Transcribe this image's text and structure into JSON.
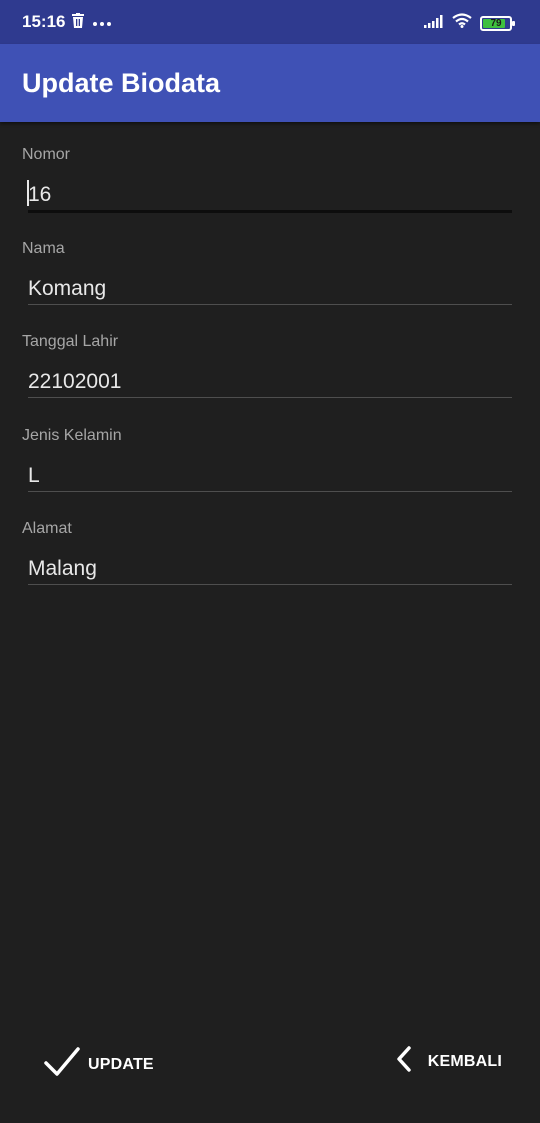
{
  "status_bar": {
    "time": "15:16",
    "battery_level": "79",
    "icons": [
      "trash-icon",
      "more-icon",
      "signal-icon",
      "wifi-icon",
      "battery-icon"
    ]
  },
  "app_bar": {
    "title": "Update Biodata",
    "color": "#3f51b5"
  },
  "form": {
    "fields": [
      {
        "label": "Nomor",
        "value": "16"
      },
      {
        "label": "Nama",
        "value": "Komang"
      },
      {
        "label": "Tanggal Lahir",
        "value": "22102001"
      },
      {
        "label": "Jenis Kelamin",
        "value": "L"
      },
      {
        "label": "Alamat",
        "value": "Malang"
      }
    ]
  },
  "actions": {
    "update_label": "UPDATE",
    "back_label": "KEMBALI"
  }
}
